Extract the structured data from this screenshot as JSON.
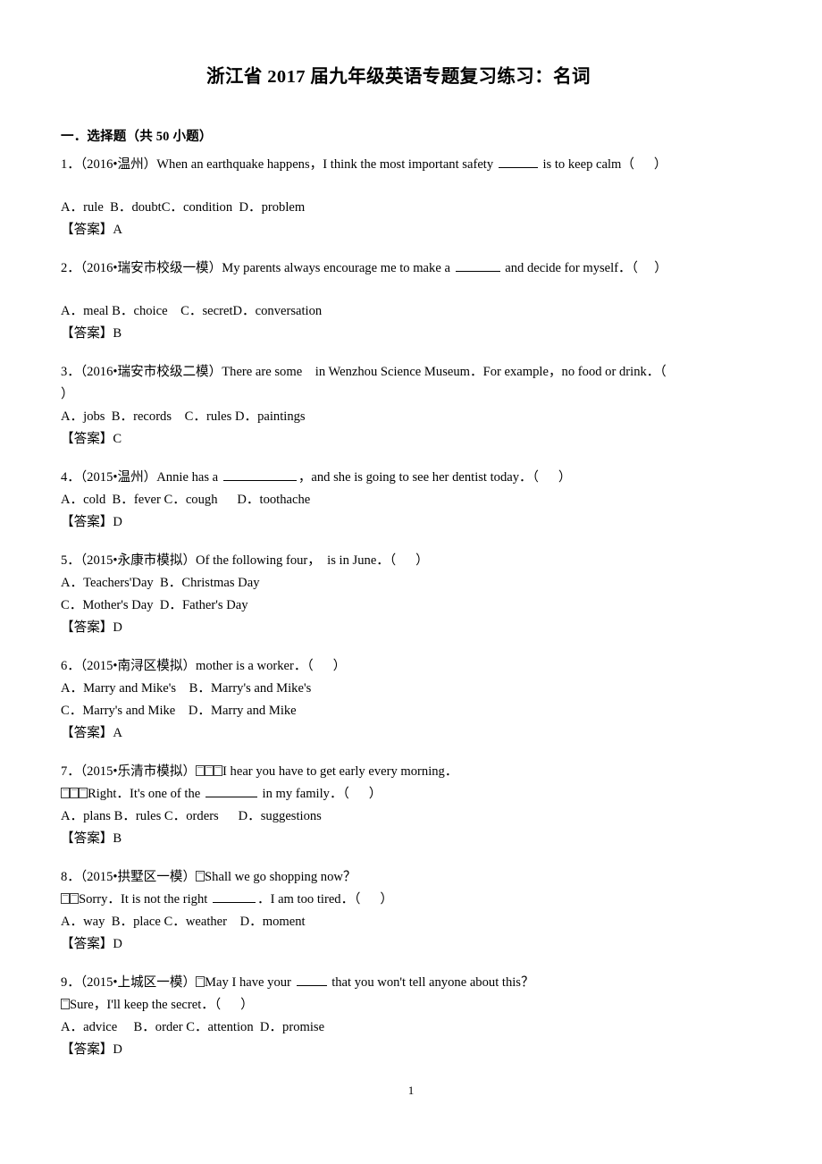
{
  "document": {
    "title": "浙江省 2017 届九年级英语专题复习练习：名词",
    "page_number": "1",
    "section_heading": "一．选择题（共 50 小题）",
    "answer_label": "【答案】"
  },
  "questions": [
    {
      "number": "1",
      "source": "（2016•温州）",
      "stem_before": "1．（2016•温州）When an earthquake happens，I think the most important safety ",
      "stem_after": " is to keep calm（      ）",
      "blank_width": 44,
      "options": "A．rule  B．doubtC．condition  D．problem",
      "answer": "A",
      "extra_gap": true
    },
    {
      "number": "2",
      "source": "（2016•瑞安市校级一模）",
      "stem_before": "2．（2016•瑞安市校级一模）My parents always encourage me to make a ",
      "stem_after": " and decide for myself．（     ）",
      "blank_width": 50,
      "options": "A．meal B．choice    C．secretD．conversation",
      "answer": "B",
      "extra_gap": true
    },
    {
      "number": "3",
      "source": "（2016•瑞安市校级二模）",
      "stem_before": "3．（2016•瑞安市校级二模）There are some    in Wenzhou Science Museum．For example，no food or drink．（",
      "stem_after": "",
      "wrap_line": "）",
      "blank_width": 0,
      "options": "A．jobs  B．records    C．rules D．paintings",
      "answer": "C",
      "extra_gap": false
    },
    {
      "number": "4",
      "source": "（2015•温州）",
      "stem_before": "4．（2015•温州）Annie has a ",
      "stem_after": "，and she is going to see her dentist today．（      ）",
      "blank_width": 82,
      "options": "A．cold  B．fever C．cough      D．toothache",
      "answer": "D",
      "extra_gap": false
    },
    {
      "number": "5",
      "source": "（2015•永康市模拟）",
      "stem_before": "5．（2015•永康市模拟）Of the following four，  is in June．（      ）",
      "stem_after": "",
      "blank_width": 0,
      "options": "A．Teachers'Day  B．Christmas Day",
      "options2": "C．Mother's Day  D．Father's Day",
      "answer": "D",
      "extra_gap": false
    },
    {
      "number": "6",
      "source": "（2015•南浔区模拟）",
      "stem_before": "6．（2015•南浔区模拟）mother is a worker．（      ）",
      "stem_after": "",
      "blank_width": 0,
      "options": "A．Marry and Mike's    B．Marry's and Mike's",
      "options2": "C．Marry's and Mike    D．Marry and Mike",
      "answer": "A",
      "extra_gap": false
    },
    {
      "number": "7",
      "source": "（2015•乐清市模拟）",
      "stem_before": "7．（2015•乐清市模拟）",
      "tofu_count": 3,
      "stem_after": "I hear you have to get early every morning．",
      "line2_tofu": 3,
      "line2_before": "Right．It's one of the ",
      "line2_after": " in my family．（      ）",
      "blank_width": 58,
      "options": "A．plans B．rules C．orders      D．suggestions",
      "answer": "B",
      "extra_gap": false
    },
    {
      "number": "8",
      "source": "（2015•拱墅区一模）",
      "stem_before": "8．（2015•拱墅区一模）",
      "tofu_count": 1,
      "stem_after": "Shall we go shopping now？",
      "line2_tofu": 2,
      "line2_before": "Sorry．It is not the right ",
      "line2_after": "．I am too tired．（      ）",
      "blank_width": 48,
      "options": "A．way  B．place C．weather    D．moment",
      "answer": "D",
      "extra_gap": false
    },
    {
      "number": "9",
      "source": "（2015•上城区一模）",
      "stem_before": "9．（2015•上城区一模）",
      "tofu_count": 1,
      "stem_after_pre": "May I have your ",
      "stem_after_post": " that you won't tell anyone about this？",
      "blank_width": 34,
      "line2_tofu": 1,
      "line2_before": "Sure，I'll keep the secret．（      ）",
      "line2_after": "",
      "options": "A．advice     B．order C．attention  D．promise",
      "answer": "D",
      "extra_gap": false
    }
  ]
}
